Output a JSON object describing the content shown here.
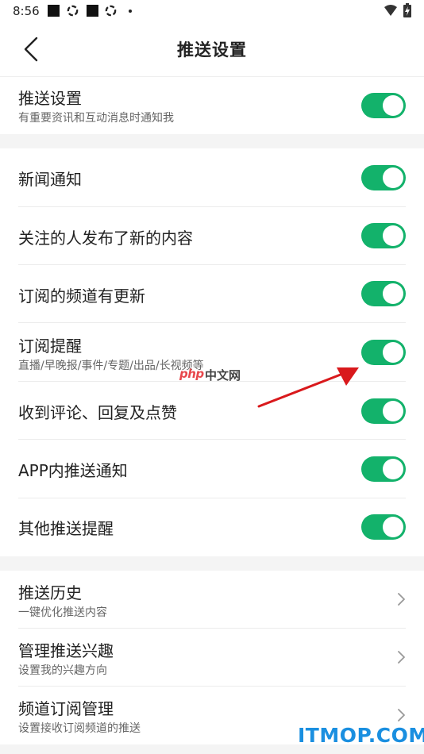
{
  "status_bar": {
    "time": "8:56"
  },
  "header": {
    "title": "推送设置"
  },
  "master": {
    "label": "推送设置",
    "sub": "有重要资讯和互动消息时通知我",
    "on": true
  },
  "toggles": [
    {
      "label": "新闻通知",
      "on": true
    },
    {
      "label": "关注的人发布了新的内容",
      "on": true
    },
    {
      "label": "订阅的频道有更新",
      "on": true
    },
    {
      "label": "订阅提醒",
      "sub": "直播/早晚报/事件/专题/出品/长视频等",
      "on": true
    },
    {
      "label": "收到评论、回复及点赞",
      "on": true
    },
    {
      "label": "APP内推送通知",
      "on": true
    },
    {
      "label": "其他推送提醒",
      "on": true
    }
  ],
  "links": [
    {
      "label": "推送历史",
      "sub": "一键优化推送内容"
    },
    {
      "label": "管理推送兴趣",
      "sub": "设置我的兴趣方向"
    },
    {
      "label": "频道订阅管理",
      "sub": "设置接收订阅频道的推送"
    }
  ],
  "watermarks": {
    "php": "php",
    "cn": "中文网",
    "itmop": "ITMOP.COM"
  },
  "colors": {
    "toggle_on": "#13b26b",
    "arrow": "#d9191c",
    "section_gap": "#f4f4f4"
  }
}
